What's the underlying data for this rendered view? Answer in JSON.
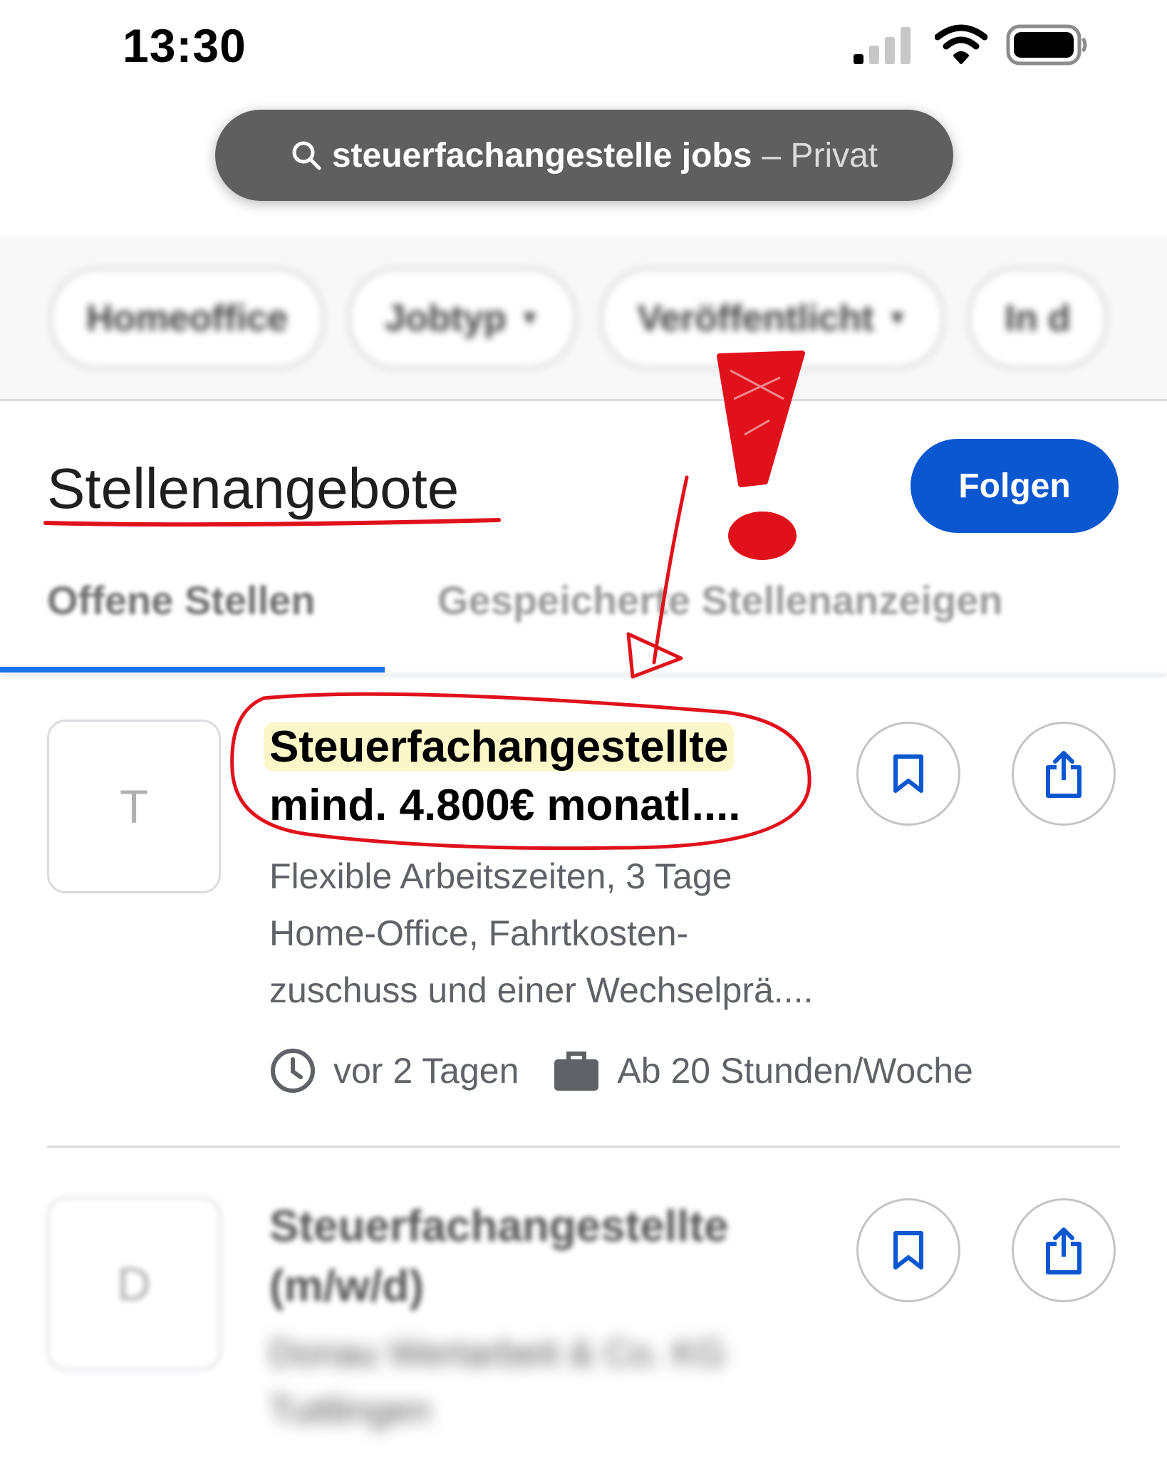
{
  "status": {
    "time": "13:30"
  },
  "url_bar": {
    "query": "steuerfachangestelle jobs",
    "mode": "– Privat"
  },
  "filters": [
    {
      "label": "Homeoffice",
      "dropdown": false
    },
    {
      "label": "Jobtyp",
      "dropdown": true
    },
    {
      "label": "Veröffentlicht",
      "dropdown": true
    },
    {
      "label": "In d",
      "dropdown": false
    }
  ],
  "section": {
    "title": "Stellenangebote",
    "follow_label": "Folgen"
  },
  "tabs": [
    "Offene Stellen",
    "Gespeicherte Stellenanzeigen"
  ],
  "jobs": [
    {
      "logo_letter": "T",
      "title_line1": "Steuerfachangestellte",
      "title_line2": "mind. 4.800€ monatl....",
      "desc_line1": "Flexible Arbeitszeiten, 3 Tage",
      "desc_line2": "Home-Office, Fahrtkosten-",
      "desc_line3": "zuschuss und einer Wechselprä....",
      "posted": "vor 2 Tagen",
      "hours": "Ab 20 Stunden/Woche"
    },
    {
      "logo_letter": "D",
      "title_line1": "Steuerfachangestellte",
      "title_line2": "(m/w/d)",
      "company_line1": "Donau Wertarbeit & Co. KG",
      "company_line2": "Tuttlingen"
    }
  ],
  "colors": {
    "accent": "#0b57d0",
    "tab_indicator": "#1a73e8",
    "annotation": "#e0111b",
    "highlight": "#fbf7c9"
  }
}
